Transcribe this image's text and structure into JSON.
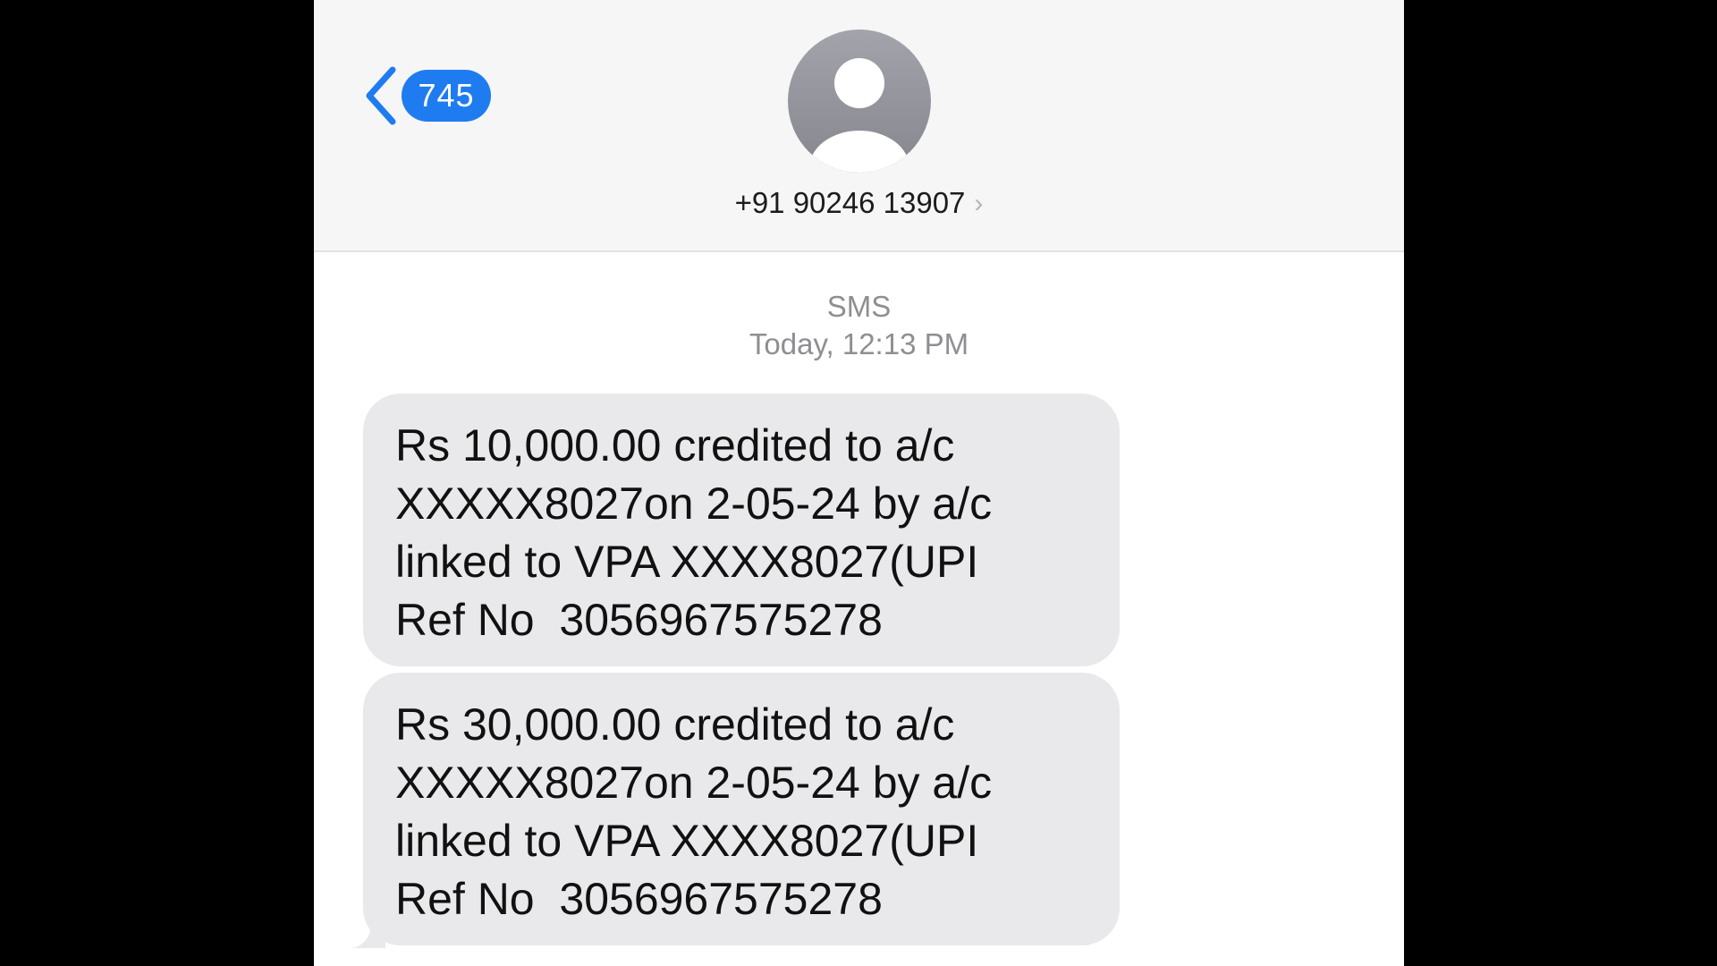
{
  "header": {
    "back_badge_count": "745",
    "contact_number": "+91 90246 13907",
    "icons": {
      "back": "chevron-left-icon",
      "avatar": "person-avatar-icon",
      "disclosure": "chevron-right-icon"
    }
  },
  "conversation": {
    "message_type": "SMS",
    "timestamp": "Today, 12:13 PM",
    "messages": [
      {
        "lines": [
          "Rs 10,000.00 credited to a/c",
          "XXXXX8027on 2-05-24 by a/c",
          "linked to VPA XXXX8027(UPI",
          "Ref No  3056967575278"
        ]
      },
      {
        "lines": [
          "Rs 30,000.00 credited to a/c",
          "XXXXX8027on 2-05-24 by a/c",
          "linked to VPA XXXX8027(UPI",
          "Ref No  3056967575278"
        ]
      }
    ]
  },
  "colors": {
    "accent": "#1f7cf0",
    "header_bg": "#f6f6f6",
    "bubble_bg": "#e9e9eb",
    "meta_text": "#8e8e93",
    "letterbox": "#000000"
  }
}
